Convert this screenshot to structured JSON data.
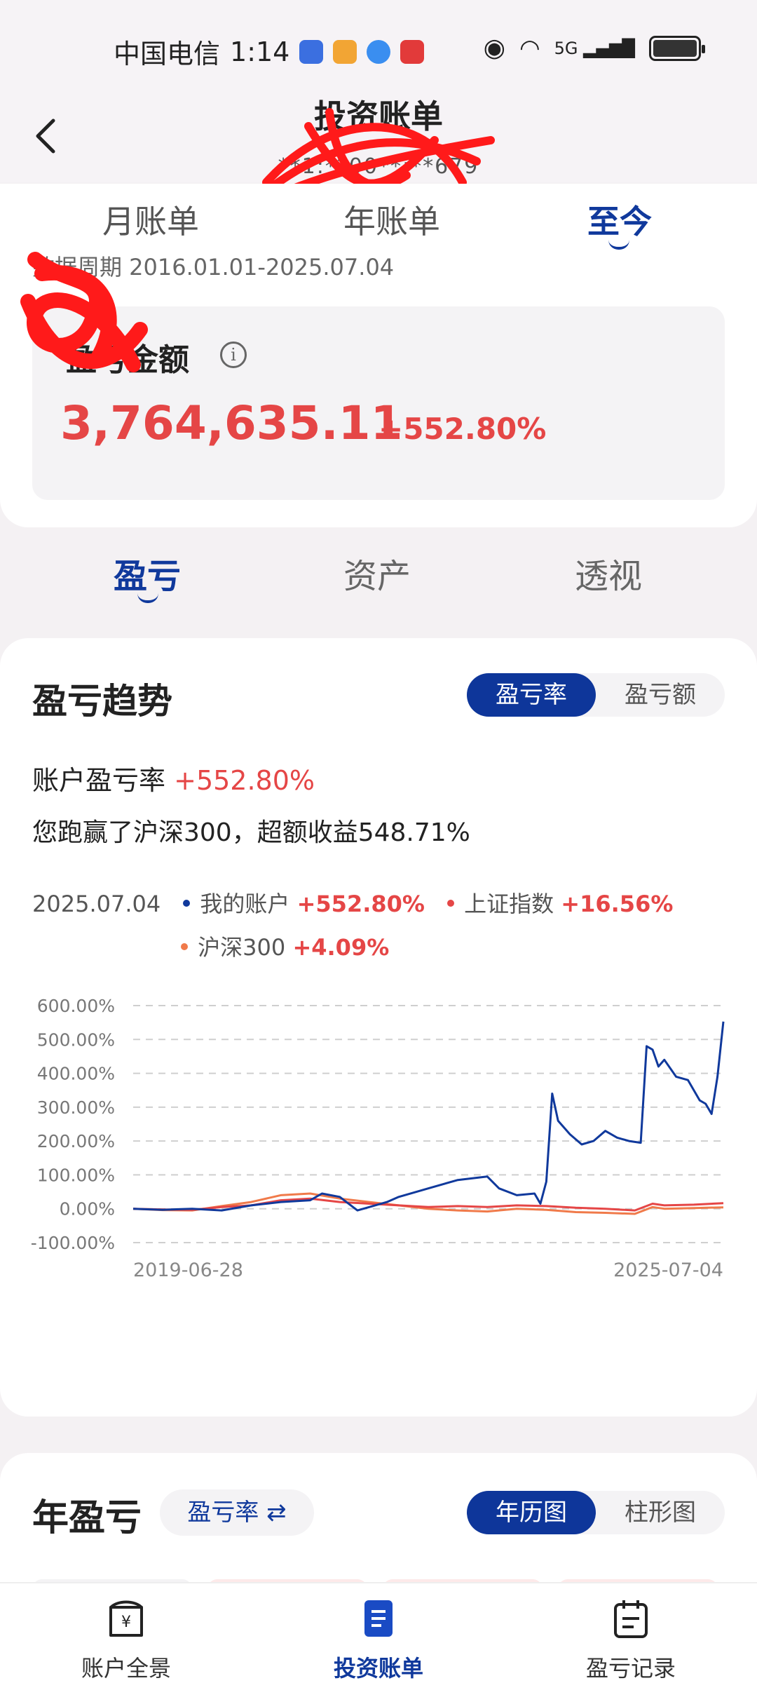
{
  "status_bar": {
    "carrier": "中国电信",
    "time": "1:14",
    "network": "5G"
  },
  "header": {
    "title": "投资账单",
    "subtitle": "**1:**00**:**679"
  },
  "period_tabs": [
    {
      "label": "月账单",
      "active": false
    },
    {
      "label": "年账单",
      "active": false
    },
    {
      "label": "至今",
      "active": true
    }
  ],
  "data_period": "数据周期 2016.01.01-2025.07.04",
  "pnl": {
    "label": "盈亏金额",
    "amount": "3,764,635.11",
    "percent": "+552.80%"
  },
  "section_tabs": [
    {
      "label": "盈亏",
      "active": true
    },
    {
      "label": "资产",
      "active": false
    },
    {
      "label": "透视",
      "active": false
    }
  ],
  "trend": {
    "title": "盈亏趋势",
    "toggle": [
      {
        "label": "盈亏率",
        "active": true
      },
      {
        "label": "盈亏额",
        "active": false
      }
    ],
    "rate_label": "账户盈亏率",
    "rate_value": "+552.80%",
    "beat_text": "您跑赢了沪深300，超额收益548.71%",
    "legend_date": "2025.07.04",
    "legend": [
      {
        "name": "我的账户",
        "value": "+552.80%",
        "color": "#10399c"
      },
      {
        "name": "上证指数",
        "value": "+16.56%",
        "color": "#e54646"
      },
      {
        "name": "沪深300",
        "value": "+4.09%",
        "color": "#f07a4a"
      }
    ]
  },
  "chart_data": {
    "type": "line",
    "x_start_label": "2019-06-28",
    "x_end_label": "2025-07-04",
    "y_ticks": [
      "600.00%",
      "500.00%",
      "400.00%",
      "300.00%",
      "200.00%",
      "100.00%",
      "0.00%",
      "-100.00%"
    ],
    "ylim": [
      -100,
      600
    ],
    "series": [
      {
        "name": "我的账户",
        "color": "#10399c",
        "x": [
          0,
          0.05,
          0.1,
          0.15,
          0.2,
          0.25,
          0.3,
          0.32,
          0.35,
          0.38,
          0.4,
          0.43,
          0.45,
          0.5,
          0.55,
          0.6,
          0.62,
          0.65,
          0.68,
          0.69,
          0.7,
          0.71,
          0.72,
          0.74,
          0.76,
          0.78,
          0.8,
          0.82,
          0.84,
          0.86,
          0.87,
          0.88,
          0.89,
          0.9,
          0.92,
          0.94,
          0.96,
          0.97,
          0.98,
          0.99,
          1.0
        ],
        "values": [
          0,
          -3,
          0,
          -5,
          10,
          20,
          25,
          45,
          35,
          -5,
          5,
          20,
          35,
          60,
          85,
          95,
          60,
          40,
          45,
          15,
          80,
          340,
          260,
          220,
          190,
          200,
          230,
          210,
          200,
          195,
          480,
          470,
          420,
          440,
          390,
          380,
          320,
          310,
          280,
          390,
          552.8
        ]
      },
      {
        "name": "上证指数",
        "color": "#e54646",
        "x": [
          0,
          0.05,
          0.1,
          0.15,
          0.2,
          0.25,
          0.3,
          0.35,
          0.4,
          0.45,
          0.5,
          0.55,
          0.6,
          0.65,
          0.7,
          0.75,
          0.8,
          0.85,
          0.88,
          0.9,
          0.95,
          1.0
        ],
        "values": [
          0,
          -2,
          -3,
          5,
          10,
          25,
          30,
          20,
          15,
          10,
          5,
          8,
          5,
          10,
          8,
          3,
          0,
          -5,
          15,
          10,
          12,
          16.56
        ]
      },
      {
        "name": "沪深300",
        "color": "#f07a4a",
        "x": [
          0,
          0.05,
          0.1,
          0.15,
          0.2,
          0.25,
          0.3,
          0.35,
          0.4,
          0.45,
          0.5,
          0.55,
          0.6,
          0.65,
          0.7,
          0.75,
          0.8,
          0.85,
          0.88,
          0.9,
          0.95,
          1.0
        ],
        "values": [
          0,
          -4,
          -5,
          8,
          20,
          40,
          45,
          30,
          20,
          10,
          0,
          -5,
          -8,
          0,
          -3,
          -10,
          -12,
          -15,
          5,
          0,
          2,
          4.09
        ]
      }
    ]
  },
  "year_section": {
    "title": "年盈亏",
    "rate_toggle": "盈亏率 ⇄",
    "view_toggle": [
      {
        "label": "年历图",
        "active": true
      },
      {
        "label": "柱形图",
        "active": false
      }
    ]
  },
  "bottom_nav": [
    {
      "label": "账户全景",
      "icon": "wallet-icon",
      "active": false
    },
    {
      "label": "投资账单",
      "icon": "bill-icon",
      "active": true
    },
    {
      "label": "盈亏记录",
      "icon": "calendar-icon",
      "active": false
    }
  ]
}
